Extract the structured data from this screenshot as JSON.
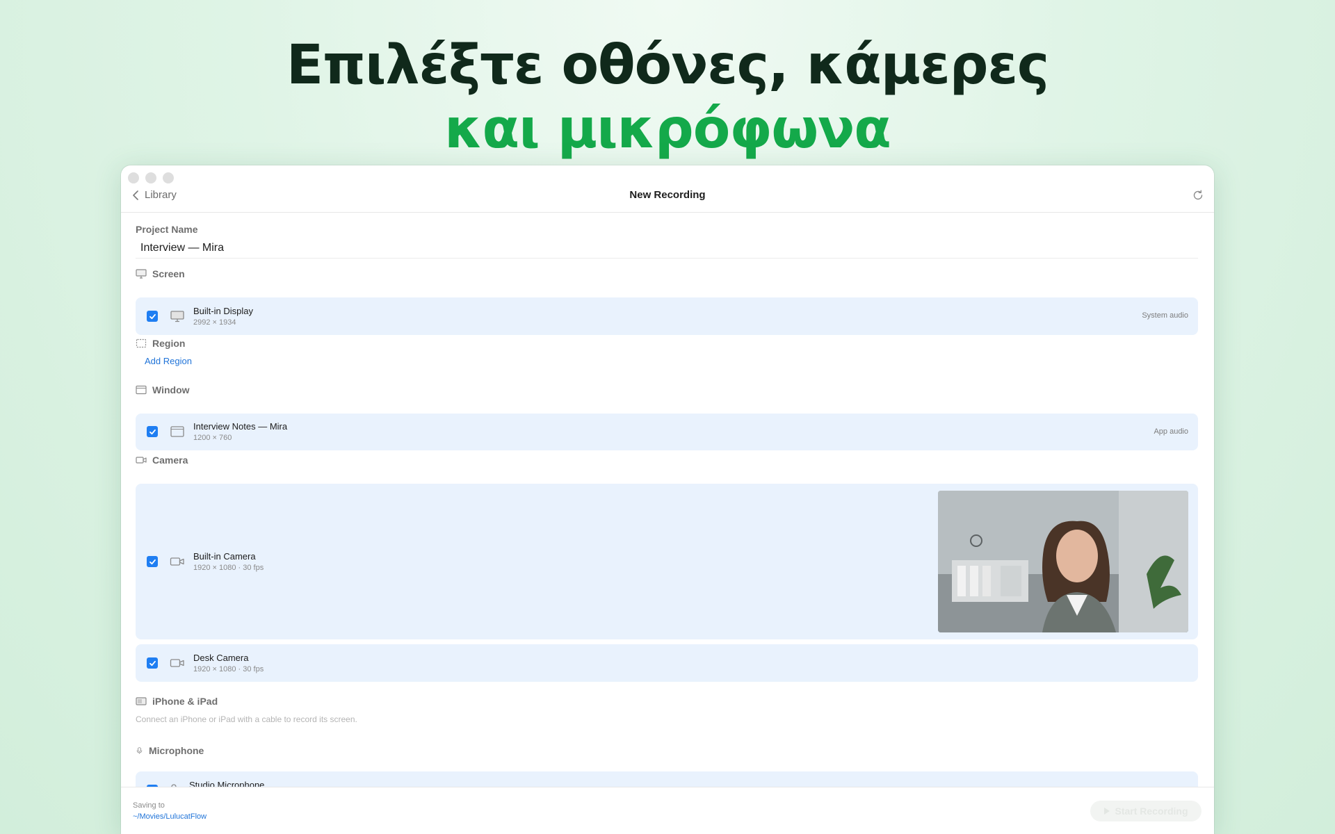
{
  "headline": {
    "line1": "Επιλέξτε οθόνες, κάμερες",
    "line2": "και μικρόφωνα"
  },
  "window": {
    "back_label": "Library",
    "title": "New Recording"
  },
  "project": {
    "label": "Project Name",
    "value": "Interview — Mira"
  },
  "sections": {
    "screen": {
      "title": "Screen",
      "item": {
        "name": "Built-in Display",
        "sub": "2992 × 1934",
        "tag": "System audio",
        "checked": true
      }
    },
    "region": {
      "title": "Region",
      "add_label": "Add Region"
    },
    "window": {
      "title": "Window",
      "item": {
        "name": "Interview Notes — Mira",
        "sub": "1200 × 760",
        "tag": "App audio",
        "checked": true
      }
    },
    "camera": {
      "title": "Camera",
      "items": [
        {
          "name": "Built-in Camera",
          "sub": "1920 × 1080 · 30 fps",
          "checked": true
        },
        {
          "name": "Desk Camera",
          "sub": "1920 × 1080 · 30 fps",
          "checked": true
        }
      ]
    },
    "iphone": {
      "title": "iPhone & iPad",
      "hint": "Connect an iPhone or iPad with a cable to record its screen."
    },
    "microphone": {
      "title": "Microphone",
      "item": {
        "name": "Studio Microphone",
        "checked": true
      }
    }
  },
  "footer": {
    "saving_label": "Saving to",
    "path": "~/Movies/LulucatFlow",
    "start_label": "Start Recording"
  },
  "colors": {
    "accent": "#1f7ef2",
    "headline_dark": "#10291b",
    "headline_green": "#14a94a",
    "row_bg": "#e9f2fd"
  }
}
